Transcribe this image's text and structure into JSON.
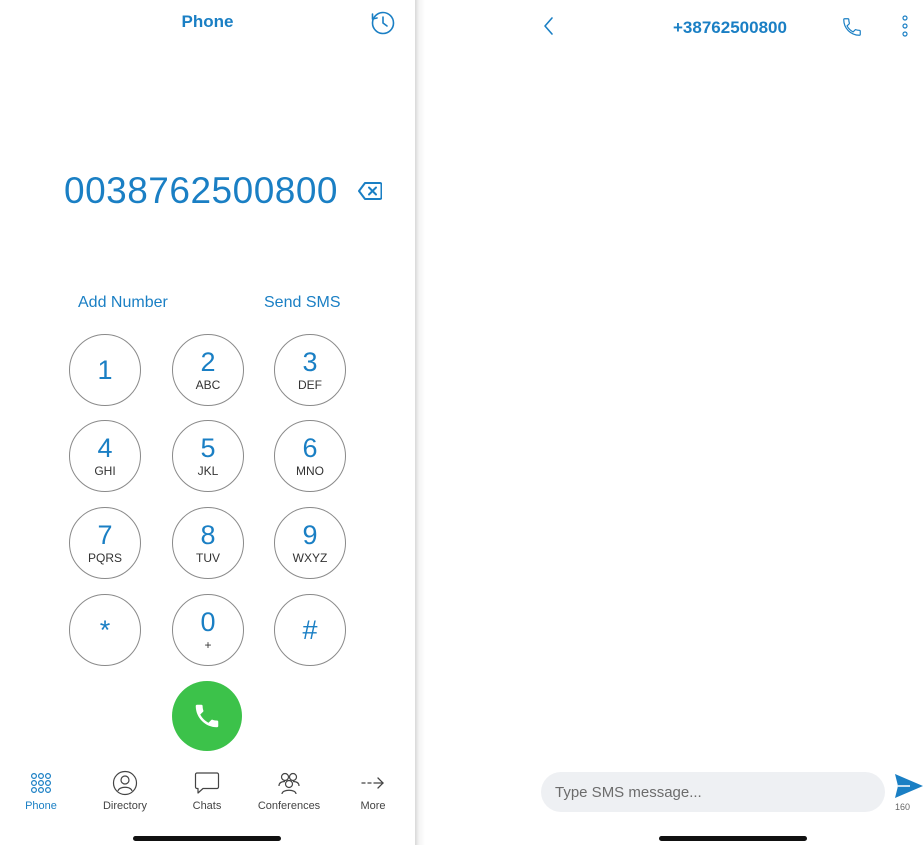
{
  "phone": {
    "title": "Phone",
    "dialed_number": "0038762500800",
    "add_number_label": "Add Number",
    "send_sms_label": "Send SMS",
    "keys": [
      {
        "digit": "1",
        "letters": ""
      },
      {
        "digit": "2",
        "letters": "ABC"
      },
      {
        "digit": "3",
        "letters": "DEF"
      },
      {
        "digit": "4",
        "letters": "GHI"
      },
      {
        "digit": "5",
        "letters": "JKL"
      },
      {
        "digit": "6",
        "letters": "MNO"
      },
      {
        "digit": "7",
        "letters": "PQRS"
      },
      {
        "digit": "8",
        "letters": "TUV"
      },
      {
        "digit": "9",
        "letters": "WXYZ"
      },
      {
        "digit": "*",
        "letters": ""
      },
      {
        "digit": "0",
        "letters": "+"
      },
      {
        "digit": "#",
        "letters": ""
      }
    ],
    "tabs": [
      {
        "label": "Phone",
        "icon": "keypad-icon",
        "active": true
      },
      {
        "label": "Directory",
        "icon": "contact-icon",
        "active": false
      },
      {
        "label": "Chats",
        "icon": "chat-bubble-icon",
        "active": false
      },
      {
        "label": "Conferences",
        "icon": "group-icon",
        "active": false
      },
      {
        "label": "More",
        "icon": "arrow-right-icon",
        "active": false
      }
    ]
  },
  "sms": {
    "contact_number": "+38762500800",
    "input_placeholder": "Type SMS message...",
    "char_count": "160"
  },
  "colors": {
    "accent": "#1a7fc4",
    "call_green": "#3cc24a",
    "input_bg": "#eef0f3"
  }
}
